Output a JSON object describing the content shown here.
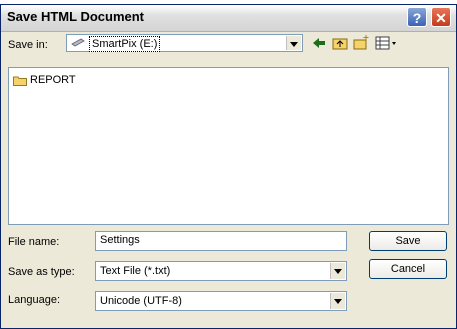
{
  "window": {
    "title": "Save HTML Document"
  },
  "titlebar": {
    "help_label": "?",
    "close_label": "✕"
  },
  "save_in": {
    "label": "Save in:",
    "value": "SmartPix (E:)"
  },
  "toolbar": {
    "back_icon": "back-arrow-icon",
    "up_icon": "up-folder-icon",
    "new_folder_icon": "new-folder-icon",
    "view_icon": "view-menu-icon"
  },
  "file_list": {
    "items": [
      {
        "name": "REPORT",
        "icon": "folder-icon"
      }
    ]
  },
  "file_name": {
    "label": "File name:",
    "value": "Settings"
  },
  "save_as_type": {
    "label": "Save as type:",
    "value": "Text File (*.txt)"
  },
  "language": {
    "label": "Language:",
    "value": "Unicode (UTF-8)"
  },
  "buttons": {
    "save": "Save",
    "cancel": "Cancel"
  },
  "colors": {
    "dialog_bg": "#ece9d8",
    "field_border": "#7f9db9",
    "close_red": "#c33a1c",
    "help_blue": "#3a63b8"
  }
}
